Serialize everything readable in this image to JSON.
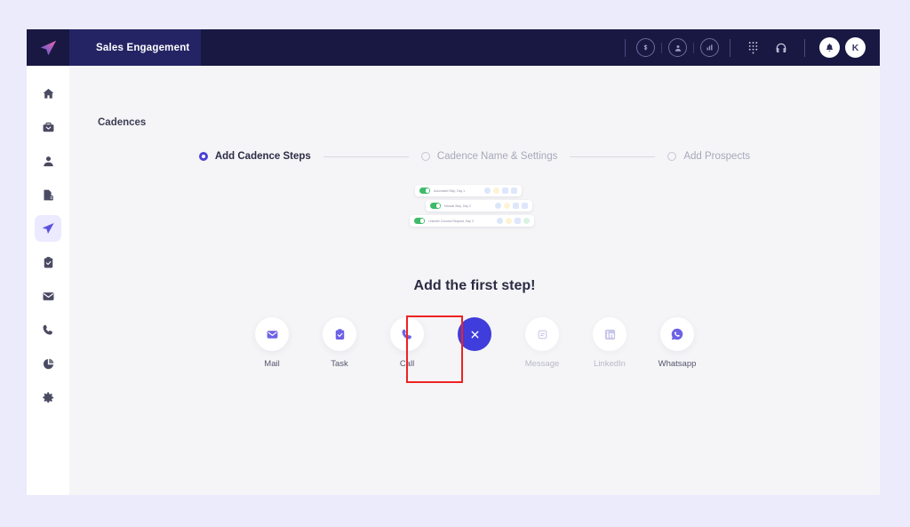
{
  "app": {
    "name": "Sales Engagement",
    "logo_icon": "paper-plane-logo"
  },
  "topbar": {
    "icons": [
      {
        "name": "dollar-circle-icon",
        "glyph": "$"
      },
      {
        "name": "person-circle-icon",
        "glyph": "●"
      },
      {
        "name": "analytics-circle-icon",
        "glyph": "▦"
      },
      {
        "name": "dialpad-icon",
        "glyph": "⁙"
      },
      {
        "name": "headset-icon",
        "glyph": "∩"
      }
    ],
    "notification_icon": "bell-icon",
    "avatar_initial": "K"
  },
  "sidebar": {
    "items": [
      {
        "name": "home",
        "icon": "home-icon",
        "active": false
      },
      {
        "name": "inbox",
        "icon": "briefcase-icon",
        "active": false
      },
      {
        "name": "contacts",
        "icon": "person-icon",
        "active": false
      },
      {
        "name": "reports",
        "icon": "document-icon",
        "active": false
      },
      {
        "name": "cadences",
        "icon": "paper-plane-icon",
        "active": true
      },
      {
        "name": "tasks",
        "icon": "clipboard-icon",
        "active": false
      },
      {
        "name": "mail",
        "icon": "envelope-icon",
        "active": false
      },
      {
        "name": "calls",
        "icon": "phone-icon",
        "active": false
      },
      {
        "name": "analytics",
        "icon": "pie-chart-icon",
        "active": false
      },
      {
        "name": "settings",
        "icon": "gear-icon",
        "active": false
      }
    ]
  },
  "page": {
    "title": "Cadences",
    "headline": "Add the first step!"
  },
  "stepper": {
    "steps": [
      {
        "label": "Add Cadence Steps",
        "active": true
      },
      {
        "label": "Cadence Name & Settings",
        "active": false
      },
      {
        "label": "Add Prospects",
        "active": false
      }
    ]
  },
  "preview": {
    "rows": [
      {
        "label": "Automated Step, Day 1",
        "enabled": true
      },
      {
        "label": "Manual Step, Day 2",
        "enabled": true
      },
      {
        "label": "LinkedIn Connect Request, Day 3",
        "enabled": true
      }
    ]
  },
  "step_buttons": [
    {
      "label": "Mail",
      "icon": "envelope-icon",
      "disabled": false
    },
    {
      "label": "Task",
      "icon": "clipboard-check-icon",
      "disabled": false
    },
    {
      "label": "Call",
      "icon": "phone-icon",
      "disabled": false,
      "highlighted": true
    },
    {
      "label": "Message",
      "icon": "message-icon",
      "disabled": true
    },
    {
      "label": "LinkedIn",
      "icon": "linkedin-icon",
      "disabled": true
    },
    {
      "label": "Whatsapp",
      "icon": "whatsapp-icon",
      "disabled": false
    }
  ],
  "close_button": {
    "name": "close-button",
    "icon": "close-x-icon"
  },
  "colors": {
    "accent": "#4b41d8",
    "close_button": "#3f3ddb",
    "topbar": "#181842",
    "topbar_panel": "#242465",
    "page_bg": "#f5f5f7",
    "outer_bg": "#ebebfb",
    "highlight": "#ee2222",
    "toggle_on": "#3fba6a"
  }
}
